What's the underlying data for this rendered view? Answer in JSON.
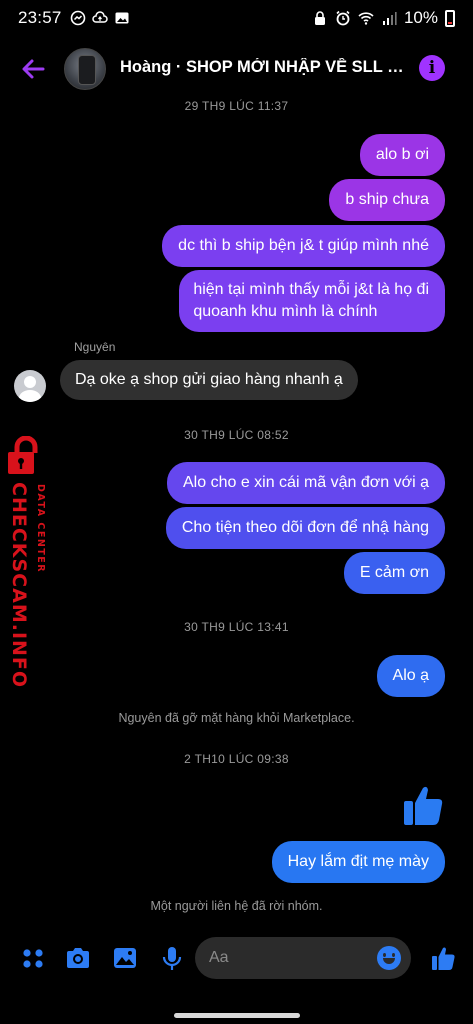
{
  "status_bar": {
    "time": "23:57",
    "battery": "10%"
  },
  "header": {
    "contact_name": "Hoàng · SHOP MỚI NHẬP VỀ SLL SA...",
    "info_glyph": "i"
  },
  "messages": {
    "ts1": "29 TH9 LÚC 11:37",
    "out1": "alo b ơi",
    "out2": "b ship chưa",
    "out3": "dc thì b ship bện j& t giúp mình nhé",
    "out4_line1": "hiện tại mình thấy mỗi j&t là họ đi",
    "out4_line2": "quoanh khu mình là chính",
    "sender_name": "Nguyên",
    "in1": "Dạ oke ạ shop gửi giao hàng nhanh ạ",
    "ts2": "30 TH9 LÚC 08:52",
    "out5": "Alo cho e xin cái mã vận đơn với ạ",
    "out6": "Cho tiện theo dõi đơn để nhậ hàng",
    "out7": "E cảm ơn",
    "ts3": "30 TH9 LÚC 13:41",
    "out8": "Alo ạ",
    "notice1": "Nguyên đã gỡ mặt hàng khỏi Marketplace.",
    "ts4": "2 TH10 LÚC 09:38",
    "out9": "Hay lắm địt mẹ mày",
    "notice2": "Một người liên hệ đã rời nhóm."
  },
  "watermark": {
    "brand": "CHECKSCAM.INFO",
    "sub": "DATA CENTER"
  },
  "composer": {
    "placeholder": "Aa"
  },
  "colors": {
    "accent_purple": "#a033ff",
    "accent_blue": "#2d7cf4",
    "incoming_bubble": "#303030",
    "watermark_red": "#d8121b"
  },
  "icons": [
    "messenger-icon",
    "cloud-icon",
    "image-icon",
    "lock-icon",
    "alarm-icon",
    "wifi-icon",
    "signal-icon",
    "battery-icon",
    "back-arrow-icon",
    "info-icon",
    "apps-icon",
    "camera-icon",
    "gallery-icon",
    "mic-icon",
    "emoji-icon",
    "thumbs-up-icon"
  ]
}
